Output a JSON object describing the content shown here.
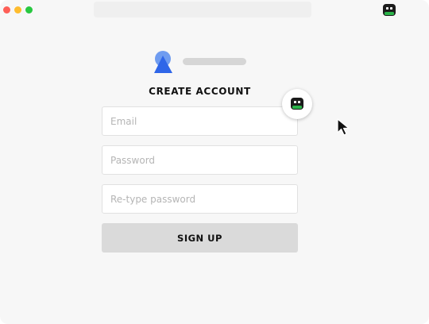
{
  "browser": {
    "window_controls": [
      "close",
      "minimize",
      "maximize"
    ],
    "extension_icon": "roboform-robot-icon"
  },
  "form": {
    "title": "CREATE ACCOUNT",
    "email_placeholder": "Email",
    "password_placeholder": "Password",
    "retype_placeholder": "Re-type password",
    "signup_label": "SIGN UP"
  },
  "colors": {
    "logo_blue": "#2f66e8",
    "logo_light_blue": "#6f9cf0",
    "robot_green": "#2bb44a",
    "button_gray": "#dadada"
  }
}
